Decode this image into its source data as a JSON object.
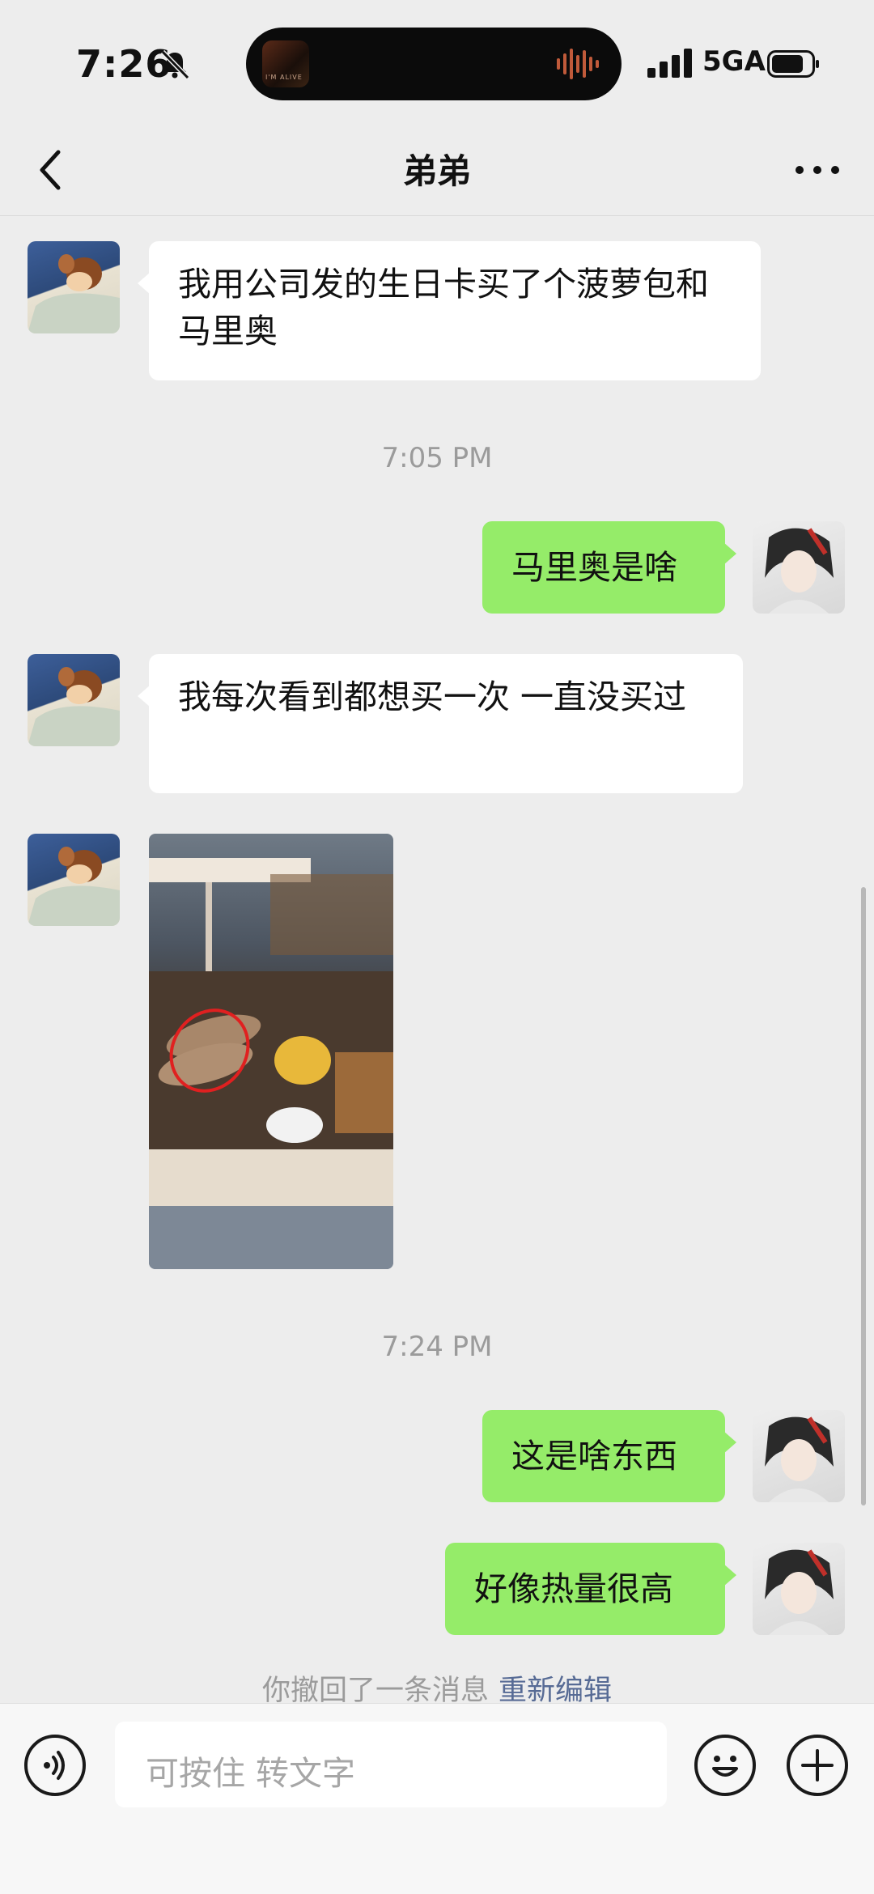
{
  "status_bar": {
    "time": "7:26",
    "network": "5GA",
    "album_text": "I'M ALIVE"
  },
  "header": {
    "title": "弟弟"
  },
  "messages": [
    {
      "side": "left",
      "text": "我用公司发的生日卡买了个菠萝包和马里奥"
    },
    {
      "timestamp": "7:05 PM"
    },
    {
      "side": "right",
      "text": "马里奥是啥"
    },
    {
      "side": "left",
      "text": "我每次看到都想买一次 一直没买过"
    },
    {
      "side": "left",
      "type": "image",
      "desc": "photo"
    },
    {
      "timestamp": "7:24 PM"
    },
    {
      "side": "right",
      "text": "这是啥东西"
    },
    {
      "side": "right",
      "text": "好像热量很高"
    }
  ],
  "recall": {
    "text": "你撤回了一条消息",
    "action": "重新编辑"
  },
  "input": {
    "placeholder": "可按住 转文字"
  },
  "icons": [
    "back-icon",
    "more-icon",
    "voice-icon",
    "emoji-icon",
    "plus-icon",
    "bell-slash-icon",
    "signal-icon",
    "battery-icon"
  ]
}
